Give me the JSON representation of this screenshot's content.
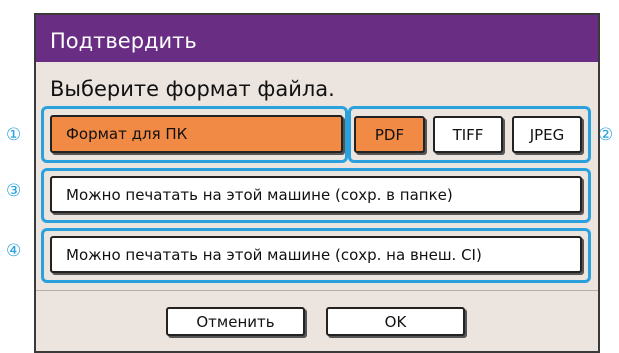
{
  "dialog": {
    "title": "Подтвердить",
    "prompt": "Выберите формат файла."
  },
  "pc_format": {
    "label": "Формат для ПК"
  },
  "formats": [
    {
      "label": "PDF",
      "selected": true
    },
    {
      "label": "TIFF",
      "selected": false
    },
    {
      "label": "JPEG",
      "selected": false
    }
  ],
  "options": [
    {
      "label": "Можно печатать на этой машине (сохр. в папке)"
    },
    {
      "label": "Можно печатать на этой машине (сохр. на внеш. CI)"
    }
  ],
  "footer": {
    "cancel_label": "Отменить",
    "ok_label": "OK"
  },
  "callouts": [
    "①",
    "②",
    "③",
    "④"
  ],
  "colors": {
    "titlebar": "#6a2d84",
    "selected": "#f18a45",
    "callout": "#2aa1dd",
    "dialog_bg": "#ebe4df"
  }
}
